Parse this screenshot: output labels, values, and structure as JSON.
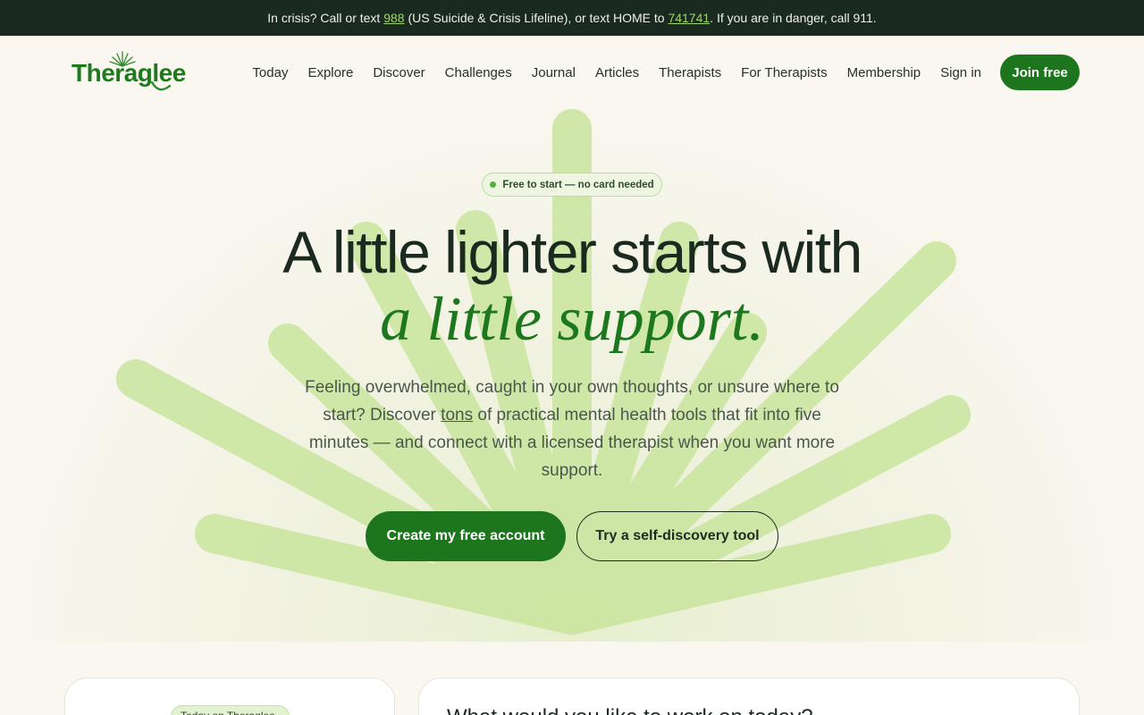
{
  "crisis": {
    "part1": "In crisis? Call or text ",
    "num1": "988",
    "part2": " (US Suicide & Crisis Lifeline), or text HOME to ",
    "num2": "741741",
    "part3": ". If you are in danger, call 911."
  },
  "brand": {
    "name": "Theraglee"
  },
  "nav": {
    "items": [
      "Today",
      "Explore",
      "Discover",
      "Challenges",
      "Journal",
      "Articles",
      "Therapists",
      "For Therapists",
      "Membership",
      "Sign in"
    ],
    "join_label": "Join free"
  },
  "hero": {
    "badge": "Free to start — no card needed",
    "headline": "A little lighter starts with",
    "headline_accent": "a little support.",
    "sub_before": "Feeling overwhelmed, caught in your own thoughts, or unsure where to start? Discover ",
    "sub_link": "tons",
    "sub_after": " of practical mental health tools that fit into five minutes — and connect with a licensed therapist when you want more support.",
    "primary_cta": "Create my free account",
    "secondary_cta": "Try a self-discovery tool"
  },
  "cards": {
    "left_pill": "Today on Theraglee",
    "right_title": "What would you like to work on today?"
  },
  "colors": {
    "brand_green": "#1d761d",
    "crisis_bg": "#1a2a21",
    "ray": "#c5e39a"
  }
}
